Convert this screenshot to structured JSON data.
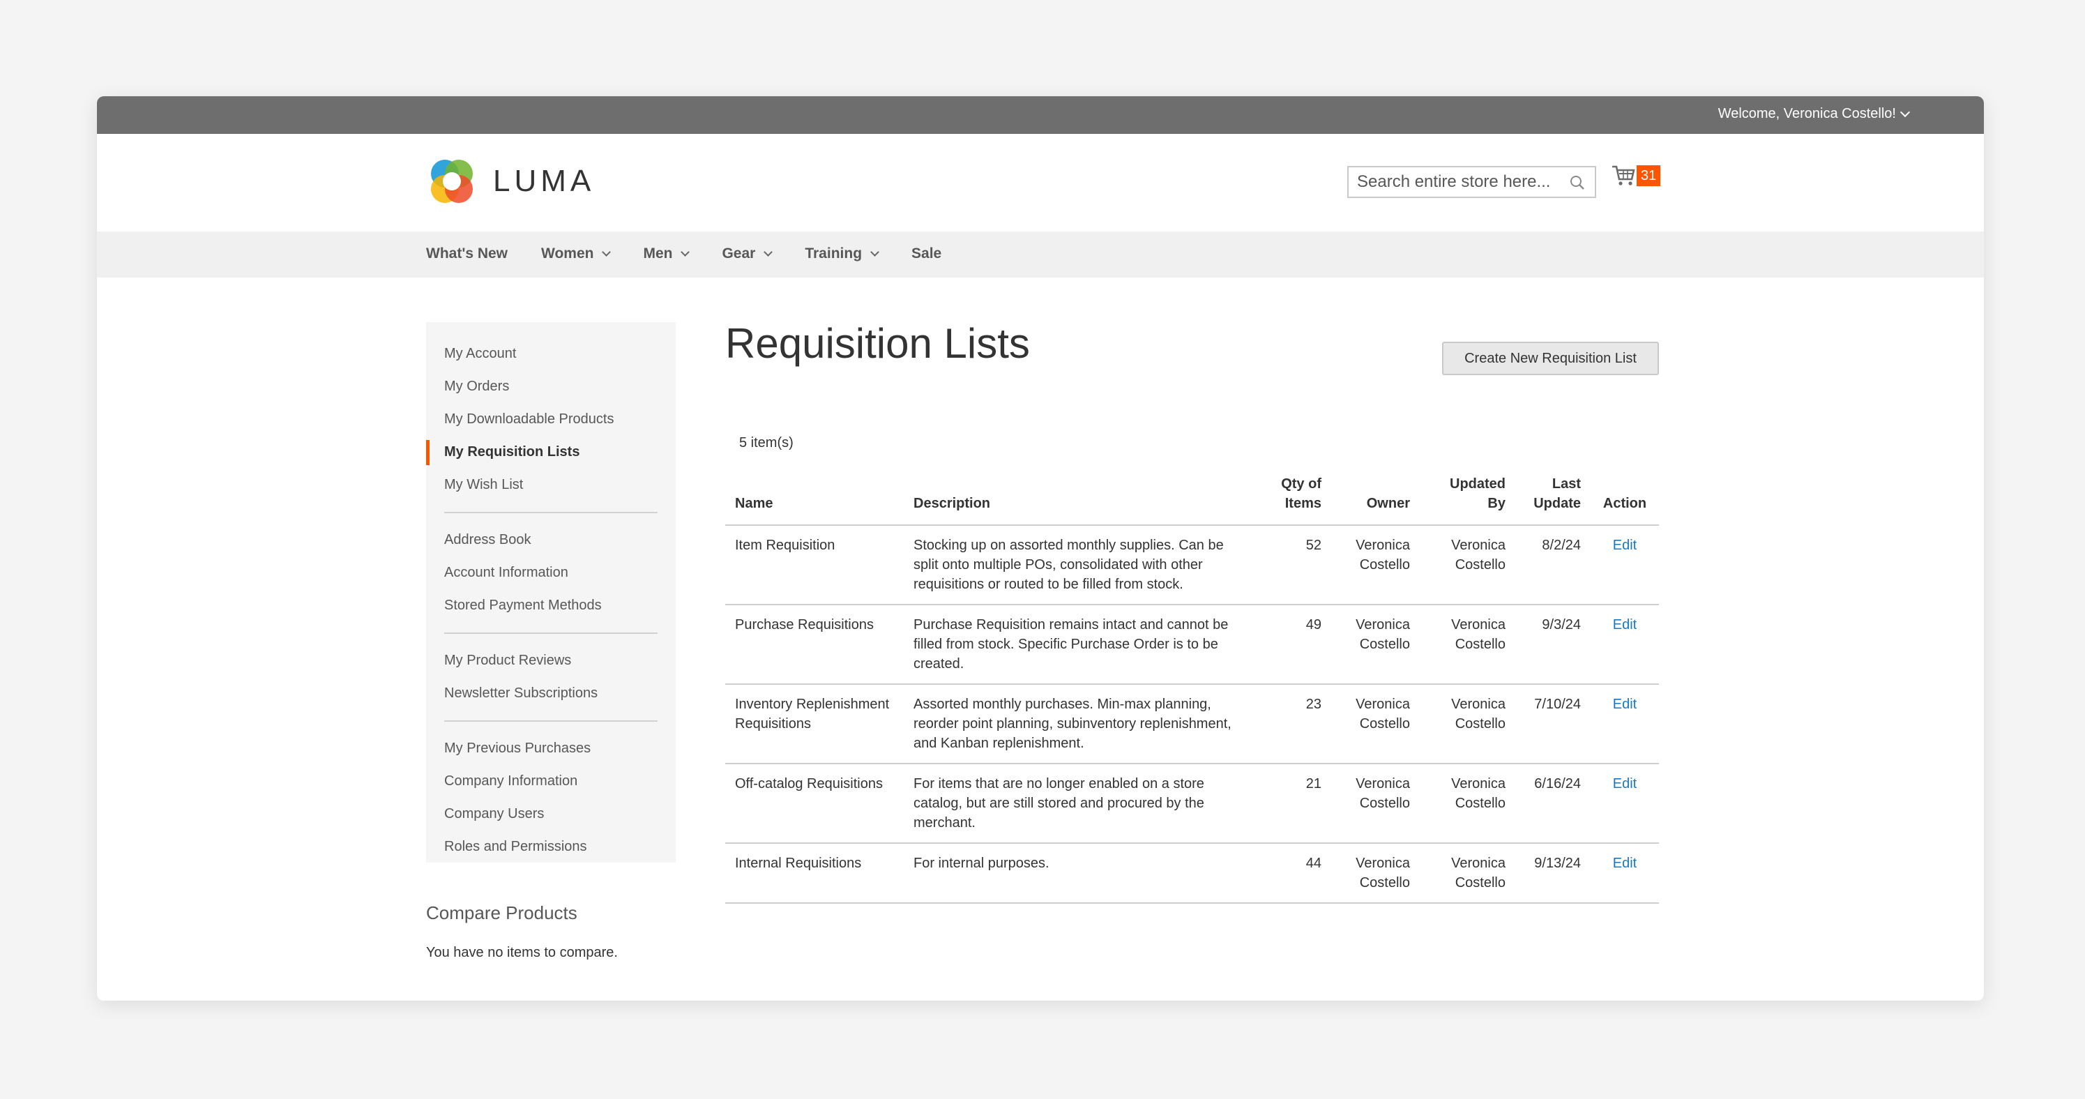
{
  "topbar": {
    "welcome": "Welcome, Veronica Costello!"
  },
  "header": {
    "logo_text": "LUMA",
    "search_placeholder": "Search entire store here...",
    "cart_count": "31"
  },
  "nav": {
    "items": [
      {
        "label": "What's New",
        "dropdown": false
      },
      {
        "label": "Women",
        "dropdown": true
      },
      {
        "label": "Men",
        "dropdown": true
      },
      {
        "label": "Gear",
        "dropdown": true
      },
      {
        "label": "Training",
        "dropdown": true
      },
      {
        "label": "Sale",
        "dropdown": false
      }
    ]
  },
  "sidebar": {
    "groups": [
      [
        "My Account",
        "My Orders",
        "My Downloadable Products",
        "My Requisition Lists",
        "My Wish List"
      ],
      [
        "Address Book",
        "Account Information",
        "Stored Payment Methods"
      ],
      [
        "My Product Reviews",
        "Newsletter Subscriptions"
      ],
      [
        "My Previous Purchases",
        "Company Information",
        "Company Users",
        "Roles and Permissions"
      ]
    ],
    "active": "My Requisition Lists"
  },
  "compare": {
    "title": "Compare Products",
    "text": "You have no items to compare."
  },
  "main": {
    "title": "Requisition Lists",
    "create_button": "Create New Requisition List",
    "count": "5 item(s)",
    "columns": {
      "name": "Name",
      "description": "Description",
      "qty": "Qty of Items",
      "owner": "Owner",
      "updated_by": "Updated By",
      "last_update": "Last Update",
      "action": "Action"
    },
    "rows": [
      {
        "name": "Item Requisition",
        "description": "Stocking up on assorted monthly supplies. Can be split onto multiple POs, consolidated with other requisitions or routed to be filled from stock.",
        "qty": "52",
        "owner": "Veronica Costello",
        "updated_by": "Veronica Costello",
        "last_update": "8/2/24",
        "action": "Edit"
      },
      {
        "name": "Purchase Requisitions",
        "description": "Purchase Requisition remains intact and cannot be filled from stock. Specific Purchase Order is to be created.",
        "qty": "49",
        "owner": "Veronica Costello",
        "updated_by": "Veronica Costello",
        "last_update": "9/3/24",
        "action": "Edit"
      },
      {
        "name": "Inventory Replenishment Requisitions",
        "description": "Assorted monthly purchases. Min-max planning, reorder point planning, subinventory replenishment, and Kanban replenishment.",
        "qty": "23",
        "owner": "Veronica Costello",
        "updated_by": "Veronica Costello",
        "last_update": "7/10/24",
        "action": "Edit"
      },
      {
        "name": "Off-catalog Requisitions",
        "description": "For items that are no longer enabled on a store catalog, but are still stored and procured by the merchant.",
        "qty": "21",
        "owner": "Veronica Costello",
        "updated_by": "Veronica Costello",
        "last_update": "6/16/24",
        "action": "Edit"
      },
      {
        "name": "Internal Requisitions",
        "description": "For internal purposes.",
        "qty": "44",
        "owner": "Veronica Costello",
        "updated_by": "Veronica Costello",
        "last_update": "9/13/24",
        "action": "Edit"
      }
    ]
  },
  "colors": {
    "accent": "#ff5501",
    "link": "#1979c3",
    "topbar": "#6e6e6e",
    "nav_bg": "#f0f0f0"
  },
  "icons": [
    "luma-logo-icon",
    "search-icon",
    "cart-icon",
    "chevron-down-icon"
  ]
}
